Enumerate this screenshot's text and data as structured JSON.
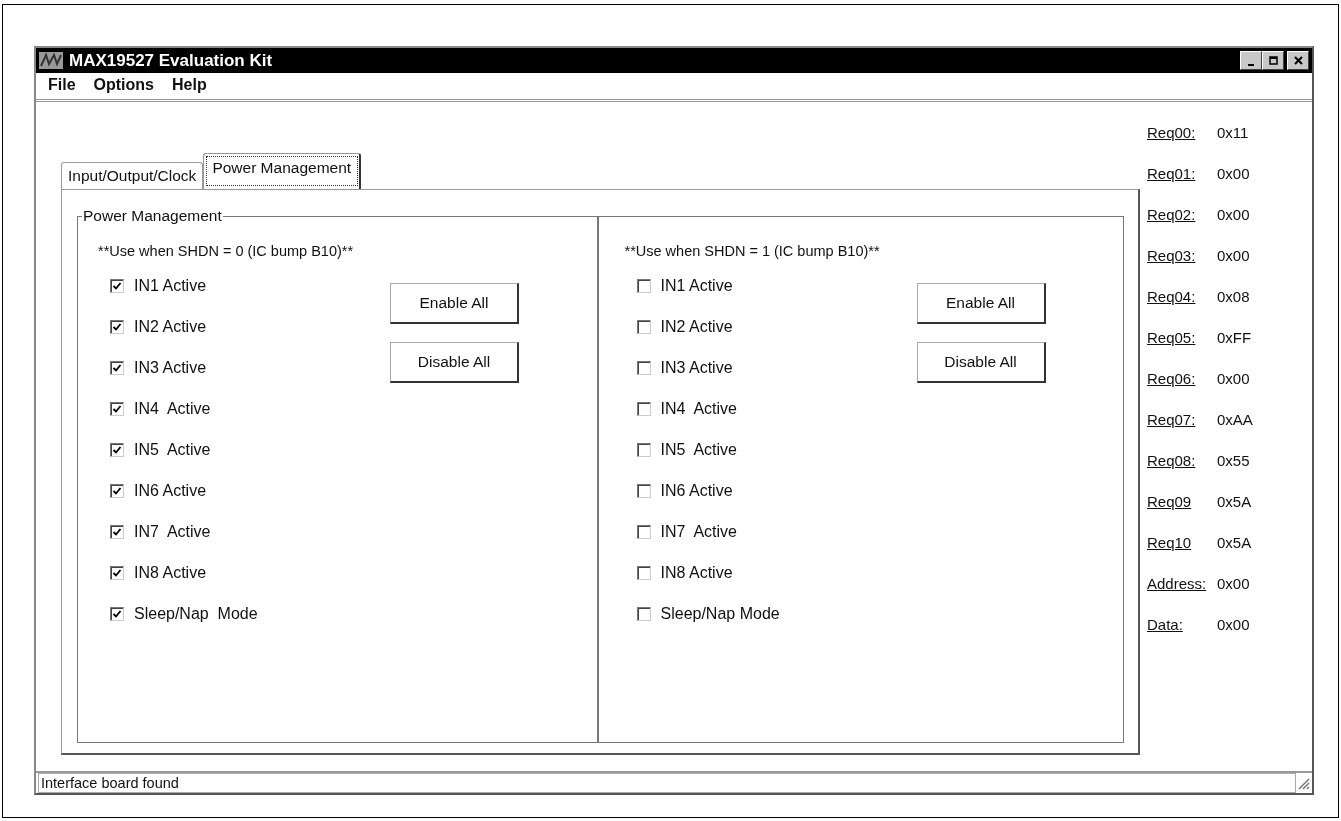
{
  "window": {
    "title": "MAX19527 Evaluation Kit"
  },
  "menu": [
    "File",
    "Options",
    "Help"
  ],
  "tabs": [
    {
      "label": "Input/Output/Clock",
      "selected": false
    },
    {
      "label": "Power Management",
      "selected": true
    }
  ],
  "group": {
    "title": "Power Management",
    "columns": [
      {
        "note": "**Use when SHDN = 0 (IC bump B10)**",
        "buttons": [
          "Enable All",
          "Disable All"
        ],
        "checkboxes": [
          {
            "label": "IN1 Active",
            "checked": true
          },
          {
            "label": "IN2 Active",
            "checked": true
          },
          {
            "label": "IN3 Active",
            "checked": true
          },
          {
            "label": "IN4  Active",
            "checked": true
          },
          {
            "label": "IN5  Active",
            "checked": true
          },
          {
            "label": "IN6 Active",
            "checked": true
          },
          {
            "label": "IN7  Active",
            "checked": true
          },
          {
            "label": "IN8 Active",
            "checked": true
          },
          {
            "label": "Sleep/Nap  Mode",
            "checked": true
          }
        ]
      },
      {
        "note": "**Use when SHDN = 1 (IC bump B10)**",
        "buttons": [
          "Enable All",
          "Disable All"
        ],
        "checkboxes": [
          {
            "label": "IN1 Active",
            "checked": false
          },
          {
            "label": "IN2 Active",
            "checked": false
          },
          {
            "label": "IN3 Active",
            "checked": false
          },
          {
            "label": "IN4  Active",
            "checked": false
          },
          {
            "label": "IN5  Active",
            "checked": false
          },
          {
            "label": "IN6 Active",
            "checked": false
          },
          {
            "label": "IN7  Active",
            "checked": false
          },
          {
            "label": "IN8 Active",
            "checked": false
          },
          {
            "label": "Sleep/Nap Mode",
            "checked": false
          }
        ]
      }
    ]
  },
  "registers": [
    {
      "label": "Req00:",
      "value": "0x11"
    },
    {
      "label": "Req01:",
      "value": "0x00"
    },
    {
      "label": "Req02:",
      "value": "0x00"
    },
    {
      "label": "Req03:",
      "value": "0x00"
    },
    {
      "label": "Req04:",
      "value": "0x08"
    },
    {
      "label": "Req05:",
      "value": "0xFF"
    },
    {
      "label": "Req06:",
      "value": "0x00"
    },
    {
      "label": "Req07:",
      "value": "0xAA"
    },
    {
      "label": "Req08:",
      "value": "0x55"
    },
    {
      "label": "Req09",
      "value": "0x5A"
    },
    {
      "label": "Req10",
      "value": "0x5A"
    },
    {
      "label": "Address:",
      "value": "0x00"
    },
    {
      "label": "Data:",
      "value": "0x00"
    }
  ],
  "status_bar": "Interface board found"
}
